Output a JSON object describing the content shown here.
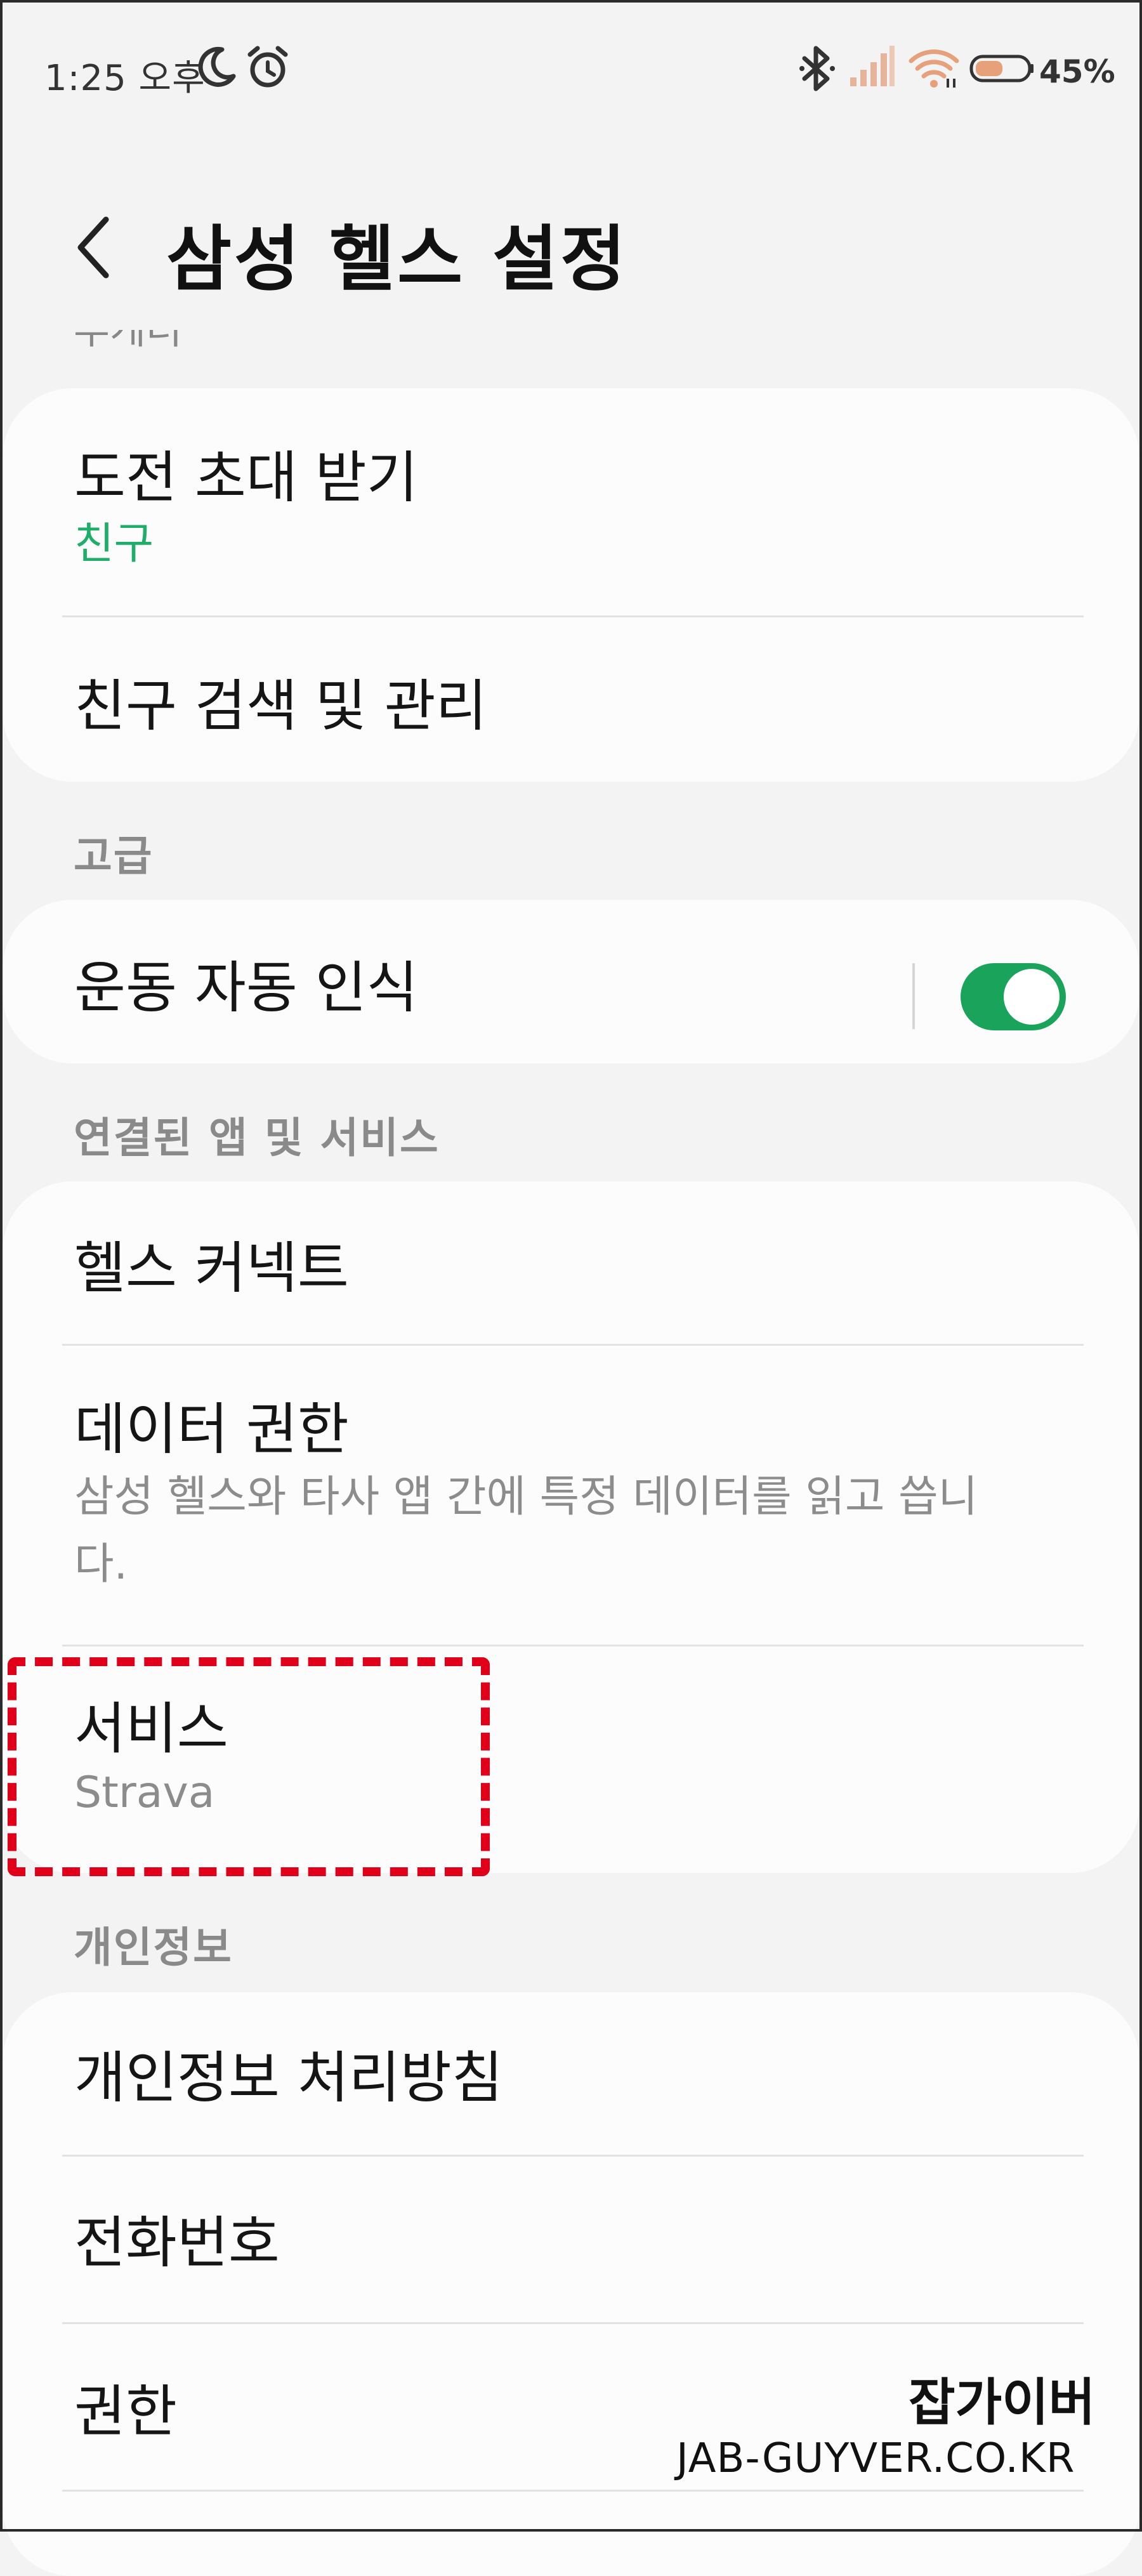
{
  "status_bar": {
    "time": "1:25 오후",
    "battery": "45%",
    "icons": [
      "moon-icon",
      "alarm-icon",
      "bluetooth-icon",
      "signal-icon",
      "wifi-icon",
      "battery-icon"
    ]
  },
  "header": {
    "title": "삼성 헬스 설정",
    "back_icon": "back-chevron-icon",
    "cut_section_label": "투게더"
  },
  "card1": {
    "rows": [
      {
        "title": "도전 초대 받기",
        "subtitle": "친구"
      },
      {
        "title": "친구 검색 및 관리"
      }
    ]
  },
  "section_advanced": {
    "header": "고급",
    "rows": [
      {
        "title": "운동 자동 인식",
        "toggle_on": true
      }
    ]
  },
  "section_connected": {
    "header": "연결된 앱 및 서비스",
    "rows": [
      {
        "title": "헬스 커넥트"
      },
      {
        "title": "데이터 권한",
        "subtitle_line1": "삼성 헬스와 타사 앱 간에 특정 데이터를 읽고 씁니",
        "subtitle_line2": "다."
      },
      {
        "title": "서비스",
        "subtitle": "Strava"
      }
    ]
  },
  "section_privacy": {
    "header": "개인정보",
    "rows": [
      {
        "title": "개인정보 처리방침"
      },
      {
        "title": "전화번호"
      },
      {
        "title": "권한"
      }
    ]
  },
  "watermark": {
    "korean": "잡가이버",
    "url": "JAB-GUYVER.CO.KR"
  },
  "colors": {
    "accent_green": "#19a35b",
    "subtitle_green": "#1fae6a",
    "highlight_red": "#e0001a",
    "background": "#f3f3f3",
    "card": "#fcfcfc"
  }
}
